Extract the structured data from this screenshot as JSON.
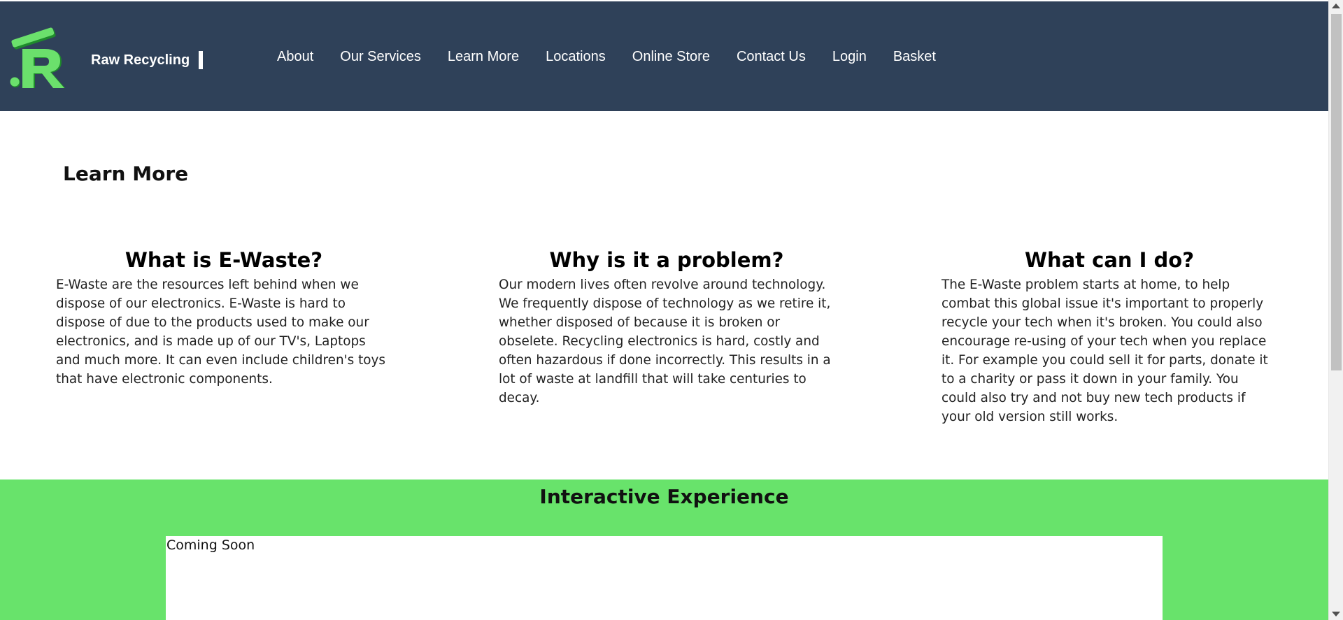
{
  "header": {
    "brand": "Raw Recycling",
    "logo_icon": "recycling-logo-icon",
    "background": "#2f4159",
    "nav": [
      {
        "label": "About"
      },
      {
        "label": "Our Services"
      },
      {
        "label": "Learn More"
      },
      {
        "label": "Locations"
      },
      {
        "label": "Online Store"
      },
      {
        "label": "Contact Us"
      },
      {
        "label": "Login"
      },
      {
        "label": "Basket"
      }
    ]
  },
  "main": {
    "title": "Learn More",
    "columns": [
      {
        "heading": "What is E-Waste?",
        "body": "E-Waste are the resources left behind when we dispose of our electronics. E-Waste is hard to dispose of due to the products used to make our electronics, and is made up of our TV's, Laptops and much more. It can even include children's toys that have electronic components."
      },
      {
        "heading": "Why is it a problem?",
        "body": "Our modern lives often revolve around technology. We frequently dispose of technology as we retire it, whether disposed of because it is broken or obselete. Recycling electronics is hard, costly and often hazardous if done incorrectly. This results in a lot of waste at landfill that will take centuries to decay."
      },
      {
        "heading": "What can I do?",
        "body": "The E-Waste problem starts at home, to help combat this global issue it's important to properly recycle your tech when it's broken. You could also encourage re-using of your tech when you replace it. For example you could sell it for parts, donate it to a charity or pass it down in your family. You could also try and not buy new tech products if your old version still works."
      }
    ]
  },
  "interactive": {
    "title": "Interactive Experience",
    "placeholder_text": "Coming Soon",
    "background": "#68e36b"
  }
}
